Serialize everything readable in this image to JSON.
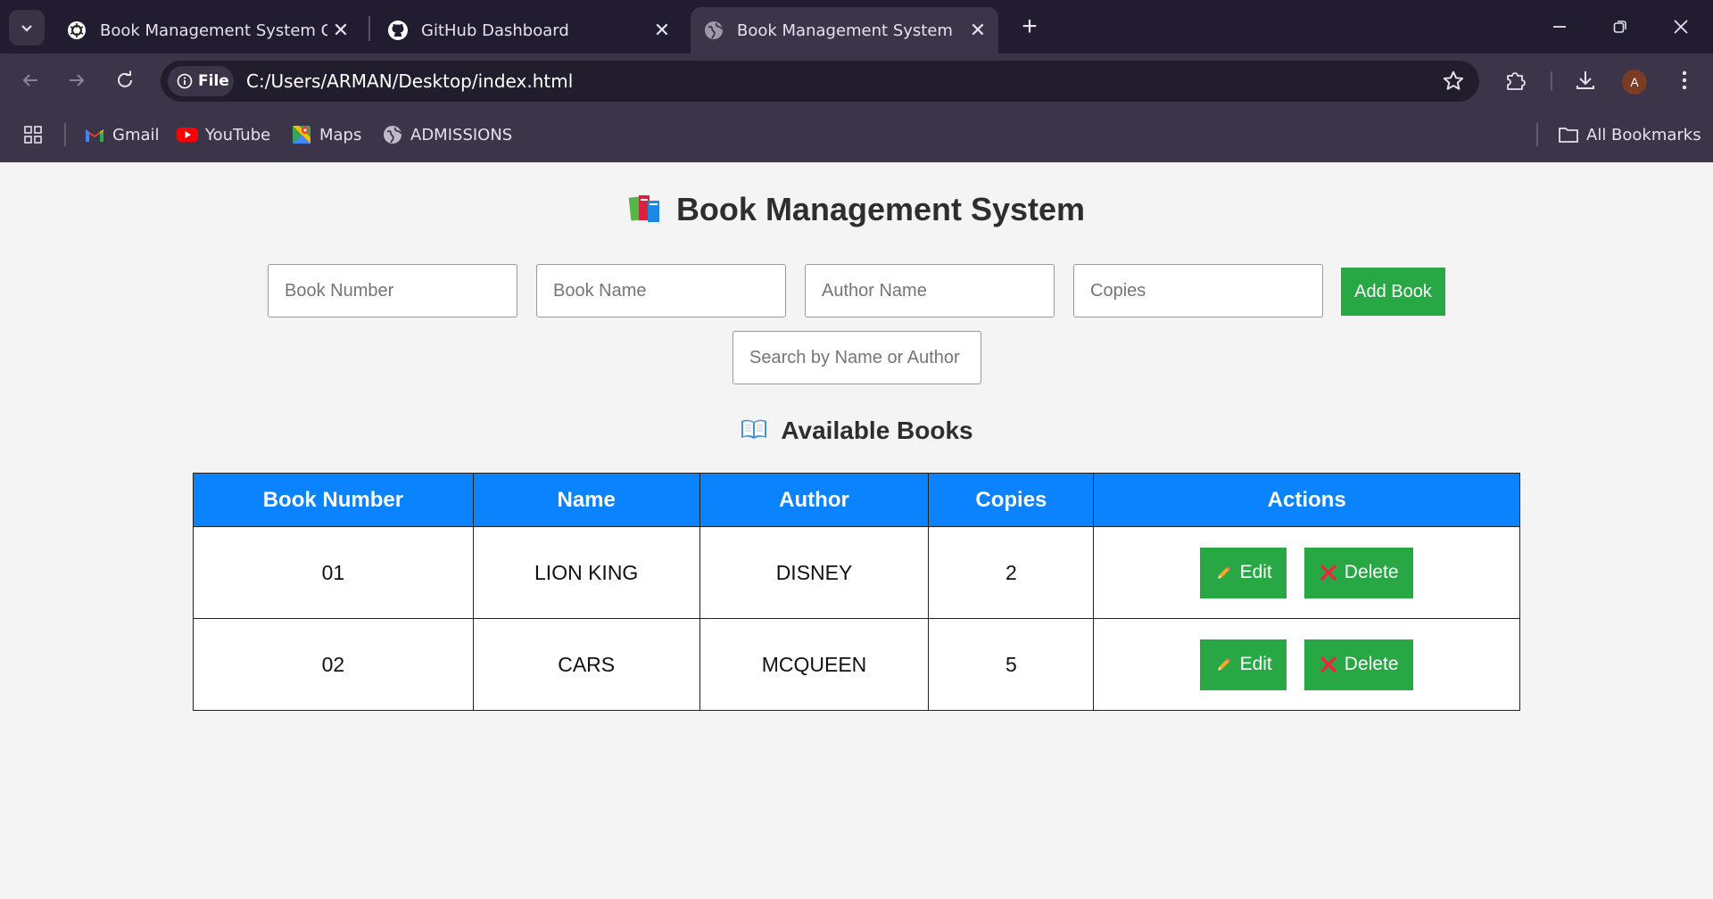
{
  "browser": {
    "tabs": [
      {
        "title": "Book Management System C++",
        "icon": "openai-icon",
        "active": false
      },
      {
        "title": "GitHub Dashboard",
        "icon": "github-icon",
        "active": false
      },
      {
        "title": "Book Management System",
        "icon": "globe-icon",
        "active": true
      }
    ],
    "address": {
      "scheme_label": "File",
      "url": "C:/Users/ARMAN/Desktop/index.html"
    },
    "profile_initial": "A",
    "bookmarks": [
      {
        "label": "Gmail",
        "icon": "gmail-icon"
      },
      {
        "label": "YouTube",
        "icon": "youtube-icon"
      },
      {
        "label": "Maps",
        "icon": "maps-icon"
      },
      {
        "label": "ADMISSIONS",
        "icon": "globe-icon"
      }
    ],
    "all_bookmarks_label": "All Bookmarks"
  },
  "page": {
    "title": "Book Management System",
    "title_icon": "books-emoji",
    "form": {
      "book_number_placeholder": "Book Number",
      "book_name_placeholder": "Book Name",
      "author_placeholder": "Author Name",
      "copies_placeholder": "Copies",
      "add_label": "Add Book",
      "search_placeholder": "Search by Name or Author"
    },
    "subtitle": "Available Books",
    "subtitle_icon": "open-book-emoji",
    "table": {
      "headers": [
        "Book Number",
        "Name",
        "Author",
        "Copies",
        "Actions"
      ],
      "rows": [
        {
          "number": "01",
          "name": "LION KING",
          "author": "DISNEY",
          "copies": "2"
        },
        {
          "number": "02",
          "name": "CARS",
          "author": "MCQUEEN",
          "copies": "5"
        }
      ],
      "edit_label": "Edit",
      "delete_label": "Delete"
    },
    "colors": {
      "accent_blue": "#0b83ff",
      "button_green": "#28a745",
      "background": "#f4f4f4"
    }
  }
}
